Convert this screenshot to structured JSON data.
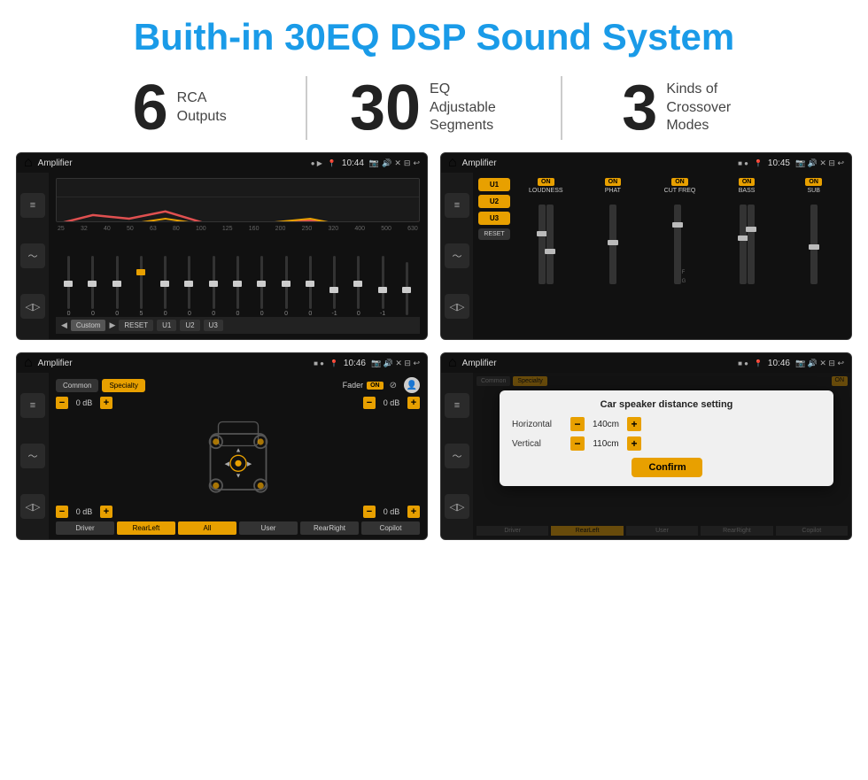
{
  "page": {
    "title": "Buith-in 30EQ DSP Sound System"
  },
  "stats": [
    {
      "number": "6",
      "label": "RCA\nOutputs"
    },
    {
      "number": "30",
      "label": "EQ Adjustable\nSegments"
    },
    {
      "number": "3",
      "label": "Kinds of\nCrossover Modes"
    }
  ],
  "screens": [
    {
      "id": "eq-screen",
      "header": {
        "title": "Amplifier",
        "time": "10:44"
      },
      "type": "eq",
      "freqs": [
        "25",
        "32",
        "40",
        "50",
        "63",
        "80",
        "100",
        "125",
        "160",
        "200",
        "250",
        "320",
        "400",
        "500",
        "630"
      ],
      "values": [
        "0",
        "0",
        "0",
        "5",
        "0",
        "0",
        "0",
        "0",
        "0",
        "0",
        "0",
        "-1",
        "0",
        "-1"
      ],
      "presets": [
        "Custom",
        "RESET",
        "U1",
        "U2",
        "U3"
      ]
    },
    {
      "id": "crossover-screen",
      "header": {
        "title": "Amplifier",
        "time": "10:45"
      },
      "type": "crossover",
      "presets": [
        "U1",
        "U2",
        "U3"
      ],
      "channels": [
        {
          "label": "LOUDNESS",
          "on": true
        },
        {
          "label": "PHAT",
          "on": true
        },
        {
          "label": "CUT FREQ",
          "on": true
        },
        {
          "label": "BASS",
          "on": true
        },
        {
          "label": "SUB",
          "on": true
        }
      ],
      "resetLabel": "RESET"
    },
    {
      "id": "fader-screen",
      "header": {
        "title": "Amplifier",
        "time": "10:46"
      },
      "type": "fader",
      "modes": [
        "Common",
        "Specialty"
      ],
      "faderLabel": "Fader",
      "onLabel": "ON",
      "zones": [
        {
          "label": "Driver",
          "db": "0 dB"
        },
        {
          "label": "RearLeft",
          "db": "0 dB"
        },
        {
          "label": "0 dB",
          "isRight": true
        },
        {
          "label": "0 dB",
          "isRight": true
        }
      ],
      "bottomBtns": [
        "Driver",
        "RearLeft",
        "All",
        "User",
        "RearRight",
        "Copilot"
      ]
    },
    {
      "id": "dialog-screen",
      "header": {
        "title": "Amplifier",
        "time": "10:46"
      },
      "type": "dialog",
      "dialog": {
        "title": "Car speaker distance setting",
        "horizontal": {
          "label": "Horizontal",
          "value": "140cm"
        },
        "vertical": {
          "label": "Vertical",
          "value": "110cm"
        },
        "confirmLabel": "Confirm"
      }
    }
  ]
}
